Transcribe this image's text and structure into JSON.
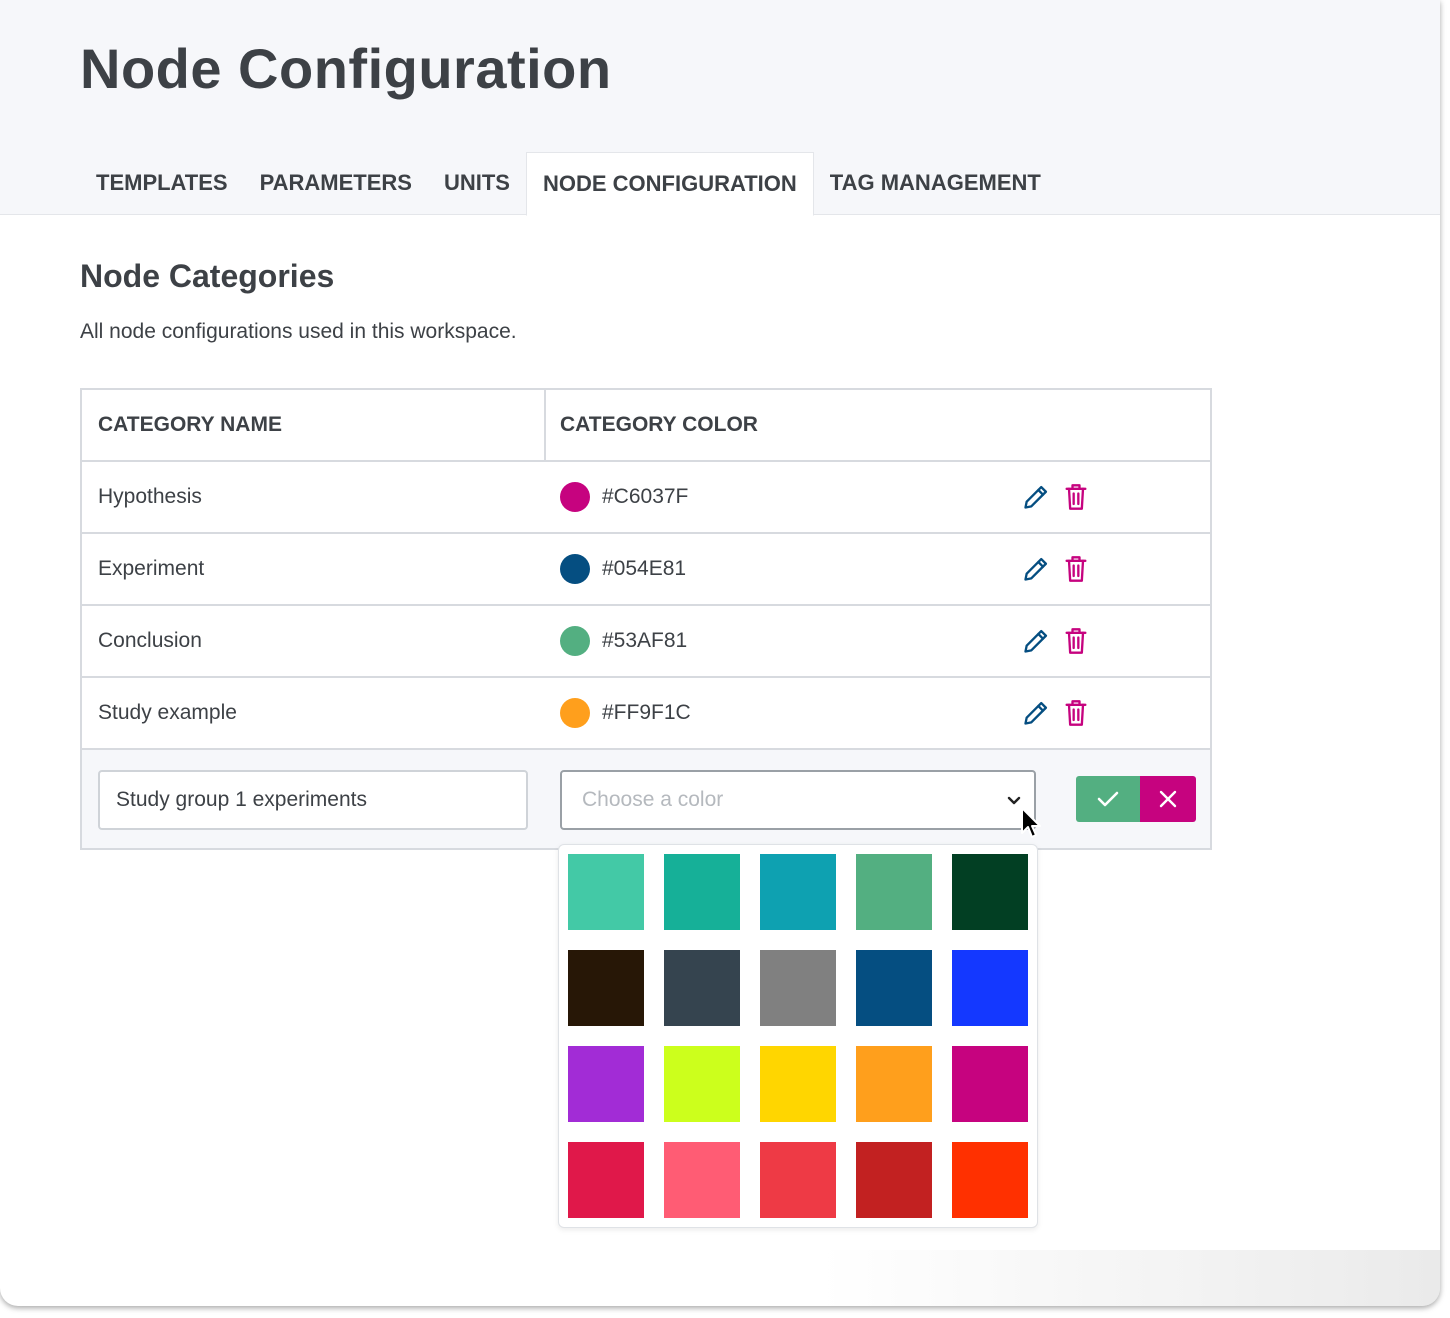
{
  "page": {
    "title": "Node Configuration"
  },
  "tabs": [
    {
      "label": "TEMPLATES",
      "active": false
    },
    {
      "label": "PARAMETERS",
      "active": false
    },
    {
      "label": "UNITS",
      "active": false
    },
    {
      "label": "NODE CONFIGURATION",
      "active": true
    },
    {
      "label": "TAG MANAGEMENT",
      "active": false
    }
  ],
  "section": {
    "title": "Node Categories",
    "description": "All node configurations used in this workspace."
  },
  "table": {
    "headers": {
      "name": "CATEGORY NAME",
      "color": "CATEGORY COLOR"
    },
    "rows": [
      {
        "name": "Hypothesis",
        "hex": "#C6037F"
      },
      {
        "name": "Experiment",
        "hex": "#054E81"
      },
      {
        "name": "Conclusion",
        "hex": "#53AF81"
      },
      {
        "name": "Study example",
        "hex": "#FF9F1C"
      }
    ]
  },
  "new_category": {
    "name_value": "Study group 1 experiments",
    "color_placeholder": "Choose a color"
  },
  "icons": {
    "edit": "pencil-icon",
    "delete": "trash-icon",
    "confirm": "check-icon",
    "cancel": "close-icon",
    "dropdown": "chevron-down-icon"
  },
  "colors": {
    "edit_icon": "#054E81",
    "delete_icon": "#C6037F",
    "confirm_button": "#53AF81",
    "cancel_button": "#C6037F"
  },
  "palette": [
    "#43C9A6",
    "#16B098",
    "#0EA1B1",
    "#53AF81",
    "#023F23",
    "#271706",
    "#35444F",
    "#808080",
    "#054E81",
    "#1438FF",
    "#A22CD6",
    "#CCFF1C",
    "#FFD600",
    "#FF9F1C",
    "#C6037F",
    "#E0184A",
    "#FF5C74",
    "#EE3A45",
    "#C22121",
    "#FF3000"
  ]
}
